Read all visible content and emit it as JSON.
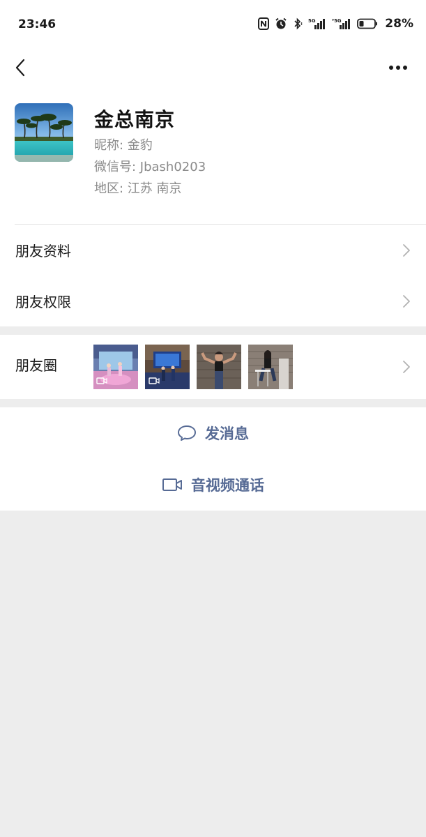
{
  "status_bar": {
    "time": "23:46",
    "battery": "28%",
    "icons": [
      "nfc-icon",
      "alarm-icon",
      "bluetooth-icon",
      "5g-signal-icon",
      "5g-signal-icon",
      "battery-icon"
    ]
  },
  "nav": {
    "back_icon": "chevron-left-icon",
    "more_icon": "more-horizontal-icon"
  },
  "profile": {
    "name": "金总南京",
    "nickname": "昵称: 金豹",
    "wechat_id": "微信号: Jbash0203",
    "region": "地区: 江苏  南京"
  },
  "menu": {
    "friend_info": "朋友资料",
    "friend_permissions": "朋友权限"
  },
  "moments": {
    "label": "朋友圈",
    "thumbnails": [
      {
        "type": "video",
        "desc": "stage performance"
      },
      {
        "type": "video",
        "desc": "stage dancers"
      },
      {
        "type": "photo",
        "desc": "person posing"
      },
      {
        "type": "photo",
        "desc": "person seated"
      }
    ]
  },
  "actions": {
    "send_message": "发消息",
    "av_call": "音视频通话"
  },
  "colors": {
    "link": "#576b95",
    "background": "#ededed",
    "text_secondary": "#8a8a8a"
  }
}
